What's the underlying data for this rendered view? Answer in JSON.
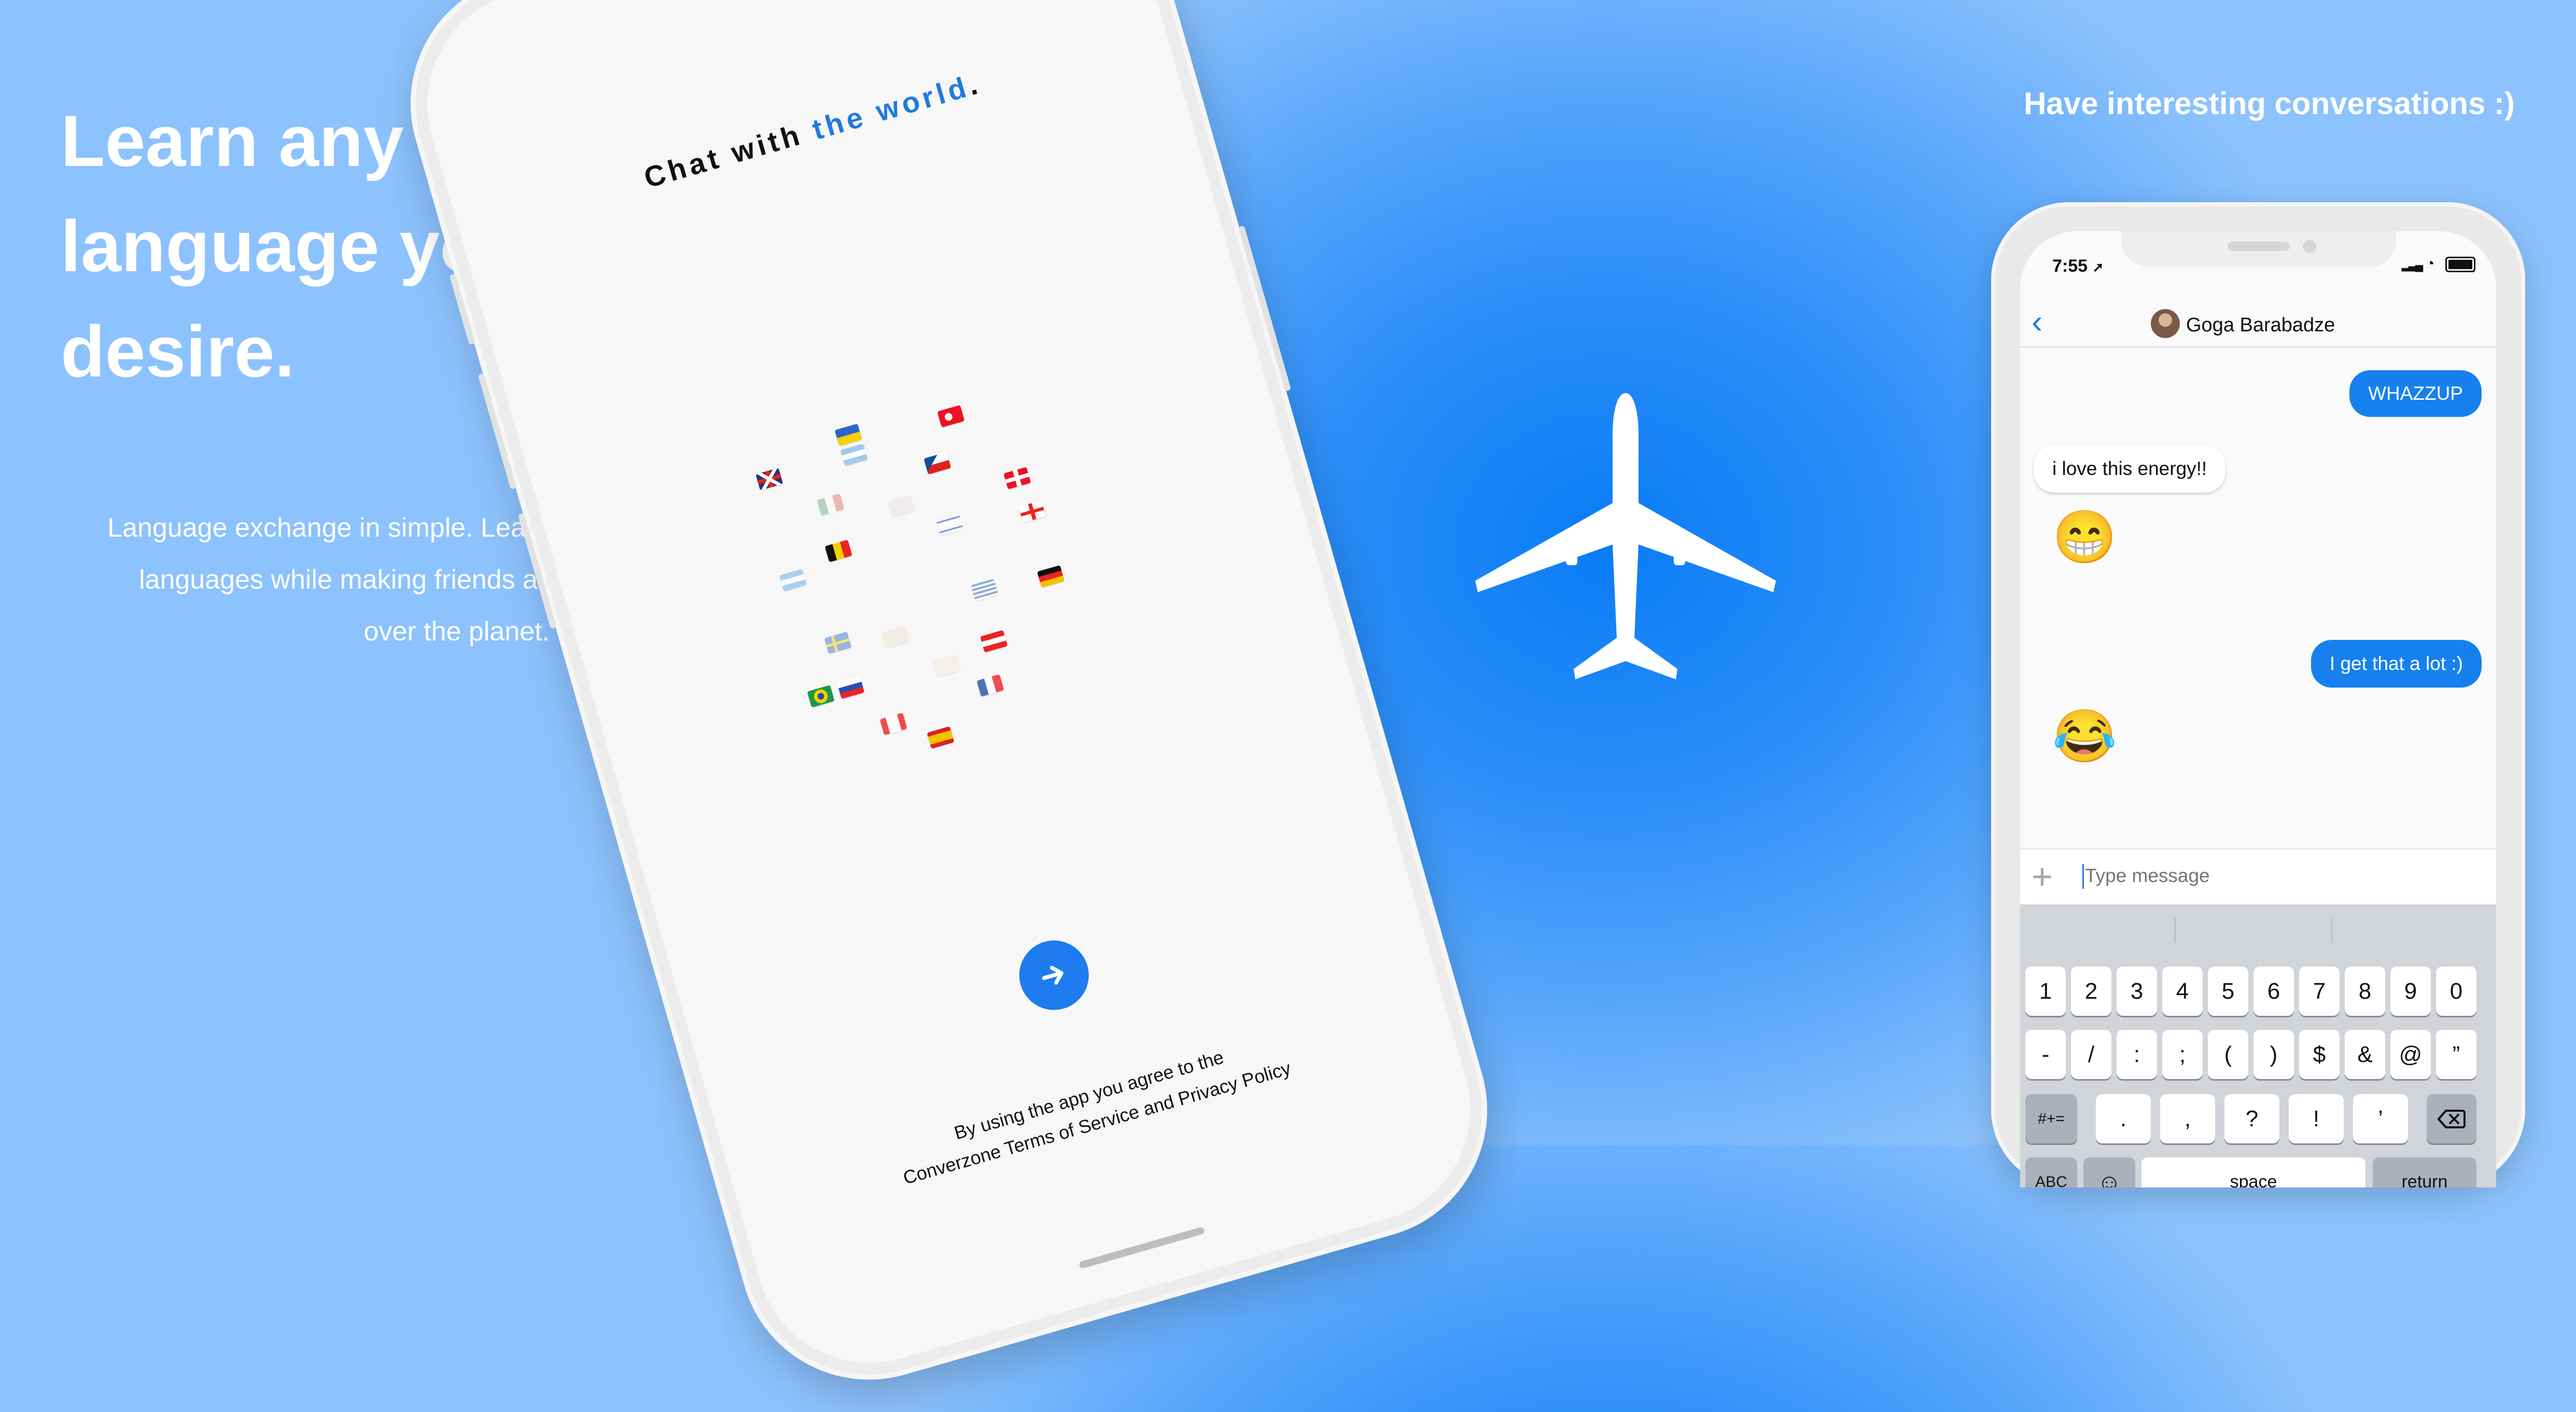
{
  "left_panel": {
    "headline_line1": "Learn any",
    "headline_line2": "language you",
    "headline_line3": "desire.",
    "sub_line1": "Language exchange in simple. Learn",
    "sub_line2": "languages while making friends all",
    "sub_line3": "over the planet."
  },
  "onboarding_screen": {
    "title_part1": "Chat with ",
    "title_accent": "the world",
    "title_end": ".",
    "next_icon": "arrow-right-icon",
    "terms_line1": "By using the app you agree to the",
    "terms_line2": "Converzone Terms of Service and Privacy Policy",
    "flag_icons": [
      "flag-uk",
      "flag-ukraine",
      "flag-turkey",
      "flag-czech",
      "flag-belgium",
      "flag-switzerland",
      "flag-israel",
      "flag-georgia",
      "flag-argentina",
      "flag-greece",
      "flag-germany",
      "flag-sweden",
      "flag-brazil",
      "flag-slovakia",
      "flag-austria",
      "flag-canada",
      "flag-france",
      "flag-spain"
    ]
  },
  "right_caption": "Have interesting conversations :)",
  "chat_screen": {
    "status_time": "7:55",
    "contact_name": "Goga Barabadze",
    "messages": [
      {
        "direction": "out",
        "text": "WHAZZUP"
      },
      {
        "direction": "in",
        "text": "i love this energy!!"
      },
      {
        "direction": "in",
        "text": "😁"
      },
      {
        "direction": "out",
        "text": "I get that a lot :)"
      },
      {
        "direction": "in",
        "text": "😂"
      }
    ],
    "composer": {
      "placeholder": "Type message",
      "plus_label": "+"
    }
  },
  "keyboard": {
    "row1": [
      "1",
      "2",
      "3",
      "4",
      "5",
      "6",
      "7",
      "8",
      "9",
      "0"
    ],
    "row2": [
      "-",
      "/",
      ":",
      ";",
      "(",
      ")",
      "$",
      "&",
      "@",
      "”"
    ],
    "shift_symbols": "#+=",
    "row3": [
      ".",
      ",",
      "?",
      "!",
      "’"
    ],
    "abc": "ABC",
    "space": "space",
    "return": "return"
  },
  "colors": {
    "accent": "#1f7ae0",
    "bubble_out": "#1680ef",
    "background": "#2b8ef9"
  }
}
